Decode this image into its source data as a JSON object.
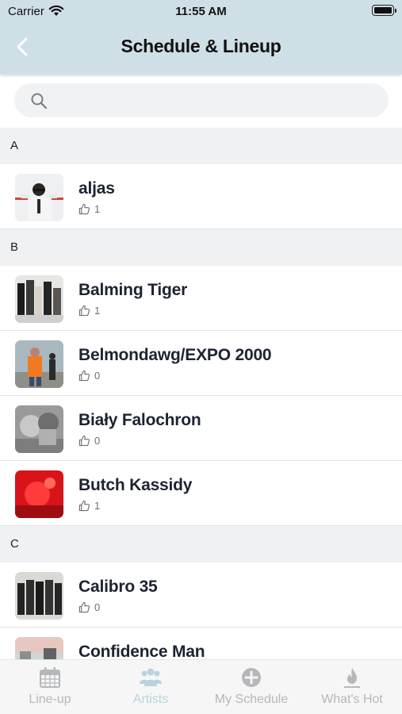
{
  "status_bar": {
    "carrier": "Carrier",
    "time": "11:55 AM"
  },
  "header": {
    "title": "Schedule & Lineup"
  },
  "search": {
    "placeholder": "",
    "value": ""
  },
  "sections": [
    {
      "letter": "A",
      "artists": [
        {
          "name": "aljas",
          "likes": "1"
        }
      ]
    },
    {
      "letter": "B",
      "artists": [
        {
          "name": "Balming Tiger",
          "likes": "1"
        },
        {
          "name": "Belmondawg/EXPO 2000",
          "likes": "0"
        },
        {
          "name": "Biały Falochron",
          "likes": "0"
        },
        {
          "name": "Butch Kassidy",
          "likes": "1"
        }
      ]
    },
    {
      "letter": "C",
      "artists": [
        {
          "name": "Calibro 35",
          "likes": "0"
        },
        {
          "name": "Confidence Man",
          "likes": ""
        }
      ]
    }
  ],
  "tabbar": {
    "items": [
      {
        "label": "Line-up",
        "icon": "calendar-icon",
        "active": false
      },
      {
        "label": "Artists",
        "icon": "people-icon",
        "active": true
      },
      {
        "label": "My Schedule",
        "icon": "plus-circle-icon",
        "active": false
      },
      {
        "label": "What's Hot",
        "icon": "flame-icon",
        "active": false
      }
    ]
  },
  "colors": {
    "header_bg": "#cfdfe6",
    "active_tab": "#b9d3dd",
    "inactive_tab": "#b5b7ba",
    "section_bg": "#f0f1f2"
  }
}
